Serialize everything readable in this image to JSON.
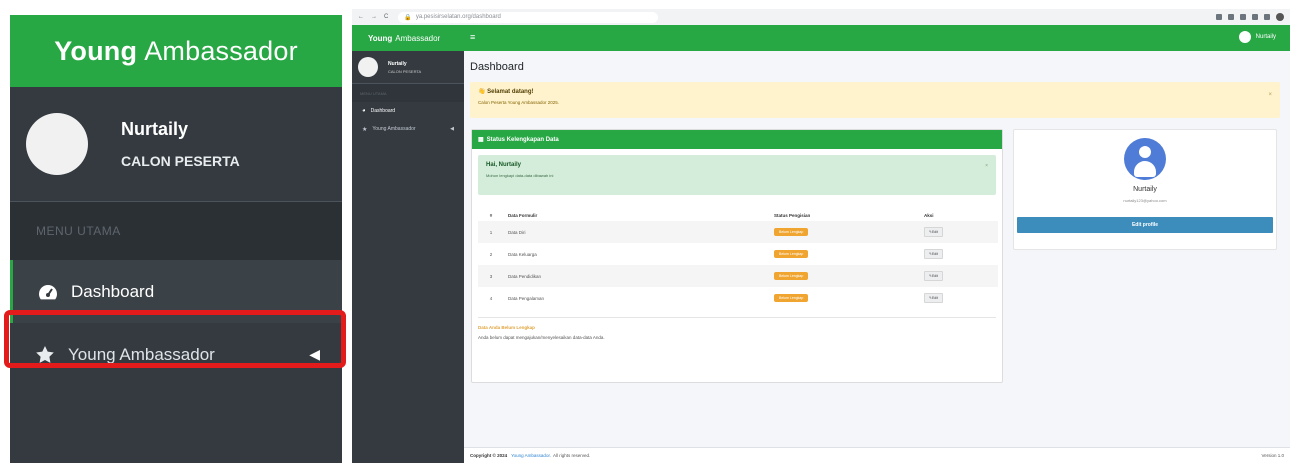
{
  "zoom": {
    "brand_bold": "Young",
    "brand_rest": "Ambassador",
    "user_name": "Nurtaily",
    "user_role": "CALON PESERTA",
    "menu_header": "MENU UTAMA",
    "items": [
      {
        "label": "Dashboard",
        "icon": "tachometer-icon"
      },
      {
        "label": "Young Ambassador",
        "icon": "star-icon"
      }
    ],
    "highlight_color": "#e31b1b"
  },
  "browser": {
    "url": "ya.pesisirselatan.org/dashboard",
    "topbar": {
      "brand_bold": "Young",
      "brand_rest": "Ambassador",
      "menu_icon": "≡",
      "user_label": "Nurtaily"
    },
    "sidebar": {
      "user_name": "Nurtaily",
      "user_role": "CALON PESERTA",
      "menu_header": "MENU UTAMA",
      "items": [
        {
          "label": "Dashboard"
        },
        {
          "label": "Young Ambassador"
        }
      ]
    },
    "page_title": "Dashboard",
    "welcome": {
      "title": "👋 Selamat datang!",
      "text": "Calon Peserta Young Ambassador 2025.",
      "close": "×"
    },
    "status_card": {
      "header": "Status Kelengkapan Data",
      "greeting_title": "Hai, Nurtaily",
      "greeting_text": "Mohon lengkapi data-data dibawah ini",
      "greeting_close": "×",
      "columns": [
        "#",
        "Data Formulir",
        "Status Pengisian",
        "Aksi"
      ],
      "rows": [
        {
          "no": "1",
          "name": "Data Diri",
          "status": "Belum Lengkap",
          "action": "Edit"
        },
        {
          "no": "2",
          "name": "Data Keluarga",
          "status": "Belum Lengkap",
          "action": "Edit"
        },
        {
          "no": "3",
          "name": "Data Pendidikan",
          "status": "Belum Lengkap",
          "action": "Edit"
        },
        {
          "no": "4",
          "name": "Data Pengalaman",
          "status": "Belum Lengkap",
          "action": "Edit"
        }
      ],
      "note_title": "Data Anda Belum Lengkap",
      "note_text": "Anda belum dapat mengajukan/menyelesaikan data-data Anda."
    },
    "profile_card": {
      "name": "Nurtaily",
      "email": "nurtaily123@yahoo.com",
      "button": "Edit profile"
    },
    "footer": {
      "prefix": "Copyright © 2024",
      "link": "Young Ambassador.",
      "suffix": "All rights reserved.",
      "version": "Version 1.0"
    },
    "colors": {
      "primary": "#28a745",
      "sidebar": "#343a40",
      "warning": "#f0a530",
      "info": "#3c8dbc"
    }
  }
}
